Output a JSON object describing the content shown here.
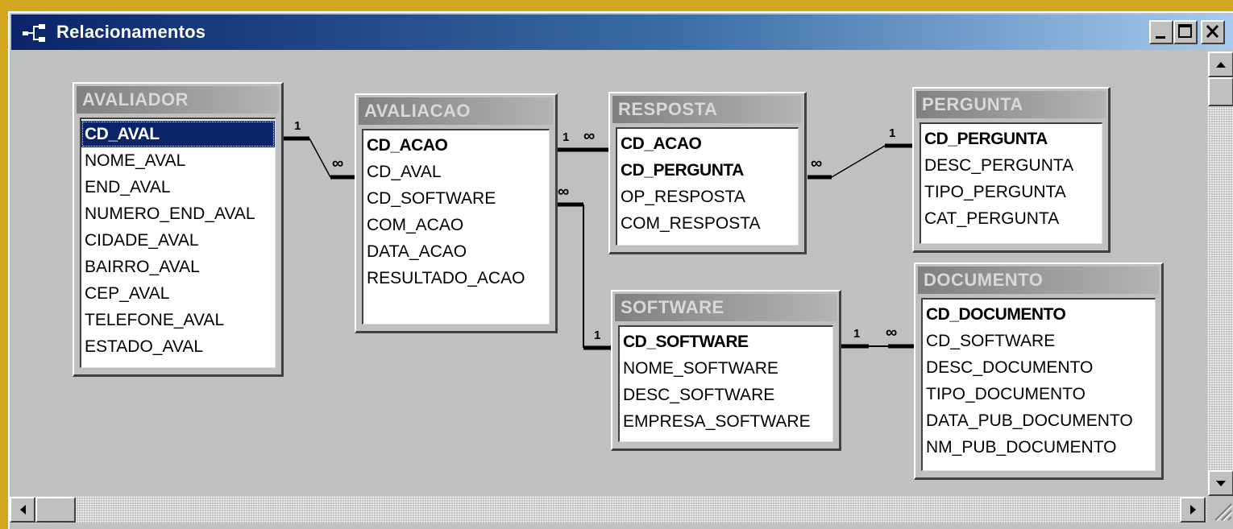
{
  "window": {
    "title": "Relacionamentos",
    "buttons": [
      "minimize",
      "maximize",
      "close"
    ]
  },
  "tables": [
    {
      "name": "AVALIADOR",
      "fields": [
        {
          "label": "CD_AVAL",
          "key": true,
          "selected": true
        },
        {
          "label": "NOME_AVAL"
        },
        {
          "label": "END_AVAL"
        },
        {
          "label": "NUMERO_END_AVAL"
        },
        {
          "label": "CIDADE_AVAL"
        },
        {
          "label": "BAIRRO_AVAL"
        },
        {
          "label": "CEP_AVAL"
        },
        {
          "label": "TELEFONE_AVAL"
        },
        {
          "label": "ESTADO_AVAL"
        }
      ]
    },
    {
      "name": "AVALIACAO",
      "fields": [
        {
          "label": "CD_ACAO",
          "key": true
        },
        {
          "label": "CD_AVAL"
        },
        {
          "label": "CD_SOFTWARE"
        },
        {
          "label": "COM_ACAO"
        },
        {
          "label": "DATA_ACAO"
        },
        {
          "label": "RESULTADO_ACAO"
        }
      ]
    },
    {
      "name": "RESPOSTA",
      "fields": [
        {
          "label": "CD_ACAO",
          "key": true
        },
        {
          "label": "CD_PERGUNTA",
          "key": true
        },
        {
          "label": "OP_RESPOSTA"
        },
        {
          "label": "COM_RESPOSTA"
        }
      ]
    },
    {
      "name": "PERGUNTA",
      "fields": [
        {
          "label": "CD_PERGUNTA",
          "key": true
        },
        {
          "label": "DESC_PERGUNTA"
        },
        {
          "label": "TIPO_PERGUNTA"
        },
        {
          "label": "CAT_PERGUNTA"
        }
      ]
    },
    {
      "name": "SOFTWARE",
      "fields": [
        {
          "label": "CD_SOFTWARE",
          "key": true
        },
        {
          "label": "NOME_SOFTWARE"
        },
        {
          "label": "DESC_SOFTWARE"
        },
        {
          "label": "EMPRESA_SOFTWARE"
        }
      ]
    },
    {
      "name": "DOCUMENTO",
      "fields": [
        {
          "label": "CD_DOCUMENTO",
          "key": true
        },
        {
          "label": "CD_SOFTWARE"
        },
        {
          "label": "DESC_DOCUMENTO"
        },
        {
          "label": "TIPO_DOCUMENTO"
        },
        {
          "label": "DATA_PUB_DOCUMENTO"
        },
        {
          "label": "NM_PUB_DOCUMENTO"
        }
      ]
    }
  ],
  "relationships": [
    {
      "from": "AVALIADOR.CD_AVAL",
      "to": "AVALIACAO.CD_AVAL",
      "one": "1",
      "many": "∞"
    },
    {
      "from": "AVALIACAO.CD_ACAO",
      "to": "RESPOSTA.CD_ACAO",
      "one": "1",
      "many": "∞"
    },
    {
      "from": "PERGUNTA.CD_PERGUNTA",
      "to": "RESPOSTA.CD_PERGUNTA",
      "one": "1",
      "many": "∞"
    },
    {
      "from": "SOFTWARE.CD_SOFTWARE",
      "to": "AVALIACAO.CD_SOFTWARE",
      "one": "1",
      "many": "∞"
    },
    {
      "from": "SOFTWARE.CD_SOFTWARE",
      "to": "DOCUMENTO.CD_SOFTWARE",
      "one": "1",
      "many": "∞"
    }
  ],
  "colors": {
    "desktop": "#d4a51f",
    "face": "#c0c0c0",
    "titlebar_start": "#0a246a",
    "titlebar_end": "#a6caf0",
    "selection": "#0a246a"
  }
}
